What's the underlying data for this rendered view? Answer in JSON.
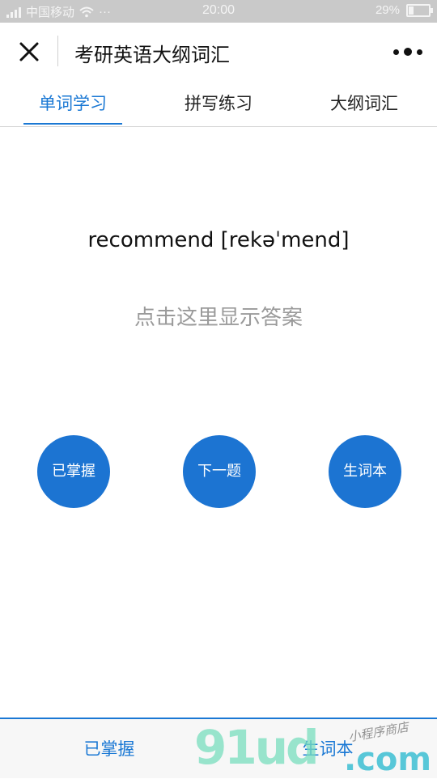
{
  "status_bar": {
    "carrier": "中国移动",
    "dots": "···",
    "time": "20:00",
    "battery": "29%",
    "battery_level": 0.29
  },
  "nav": {
    "title": "考研英语大纲词汇",
    "close_icon": "close-icon",
    "more_icon": "more-dots-icon"
  },
  "tabs": [
    {
      "label": "单词学习",
      "active": true
    },
    {
      "label": "拼写练习",
      "active": false
    },
    {
      "label": "大纲词汇",
      "active": false
    }
  ],
  "word": {
    "text": "recommend [rekəˈmend]"
  },
  "reveal_label": "点击这里显示答案",
  "actions": {
    "mastered": "已掌握",
    "next": "下一题",
    "vocab_book": "生词本"
  },
  "bottom_bar": {
    "left": "已掌握",
    "right": "生词本"
  },
  "watermark": {
    "big": "91ud",
    "com": ".com",
    "small": "小程序商店"
  },
  "colors": {
    "accent": "#1a78d4",
    "button": "#1c74d2",
    "status_bar": "#c9c9c9"
  }
}
